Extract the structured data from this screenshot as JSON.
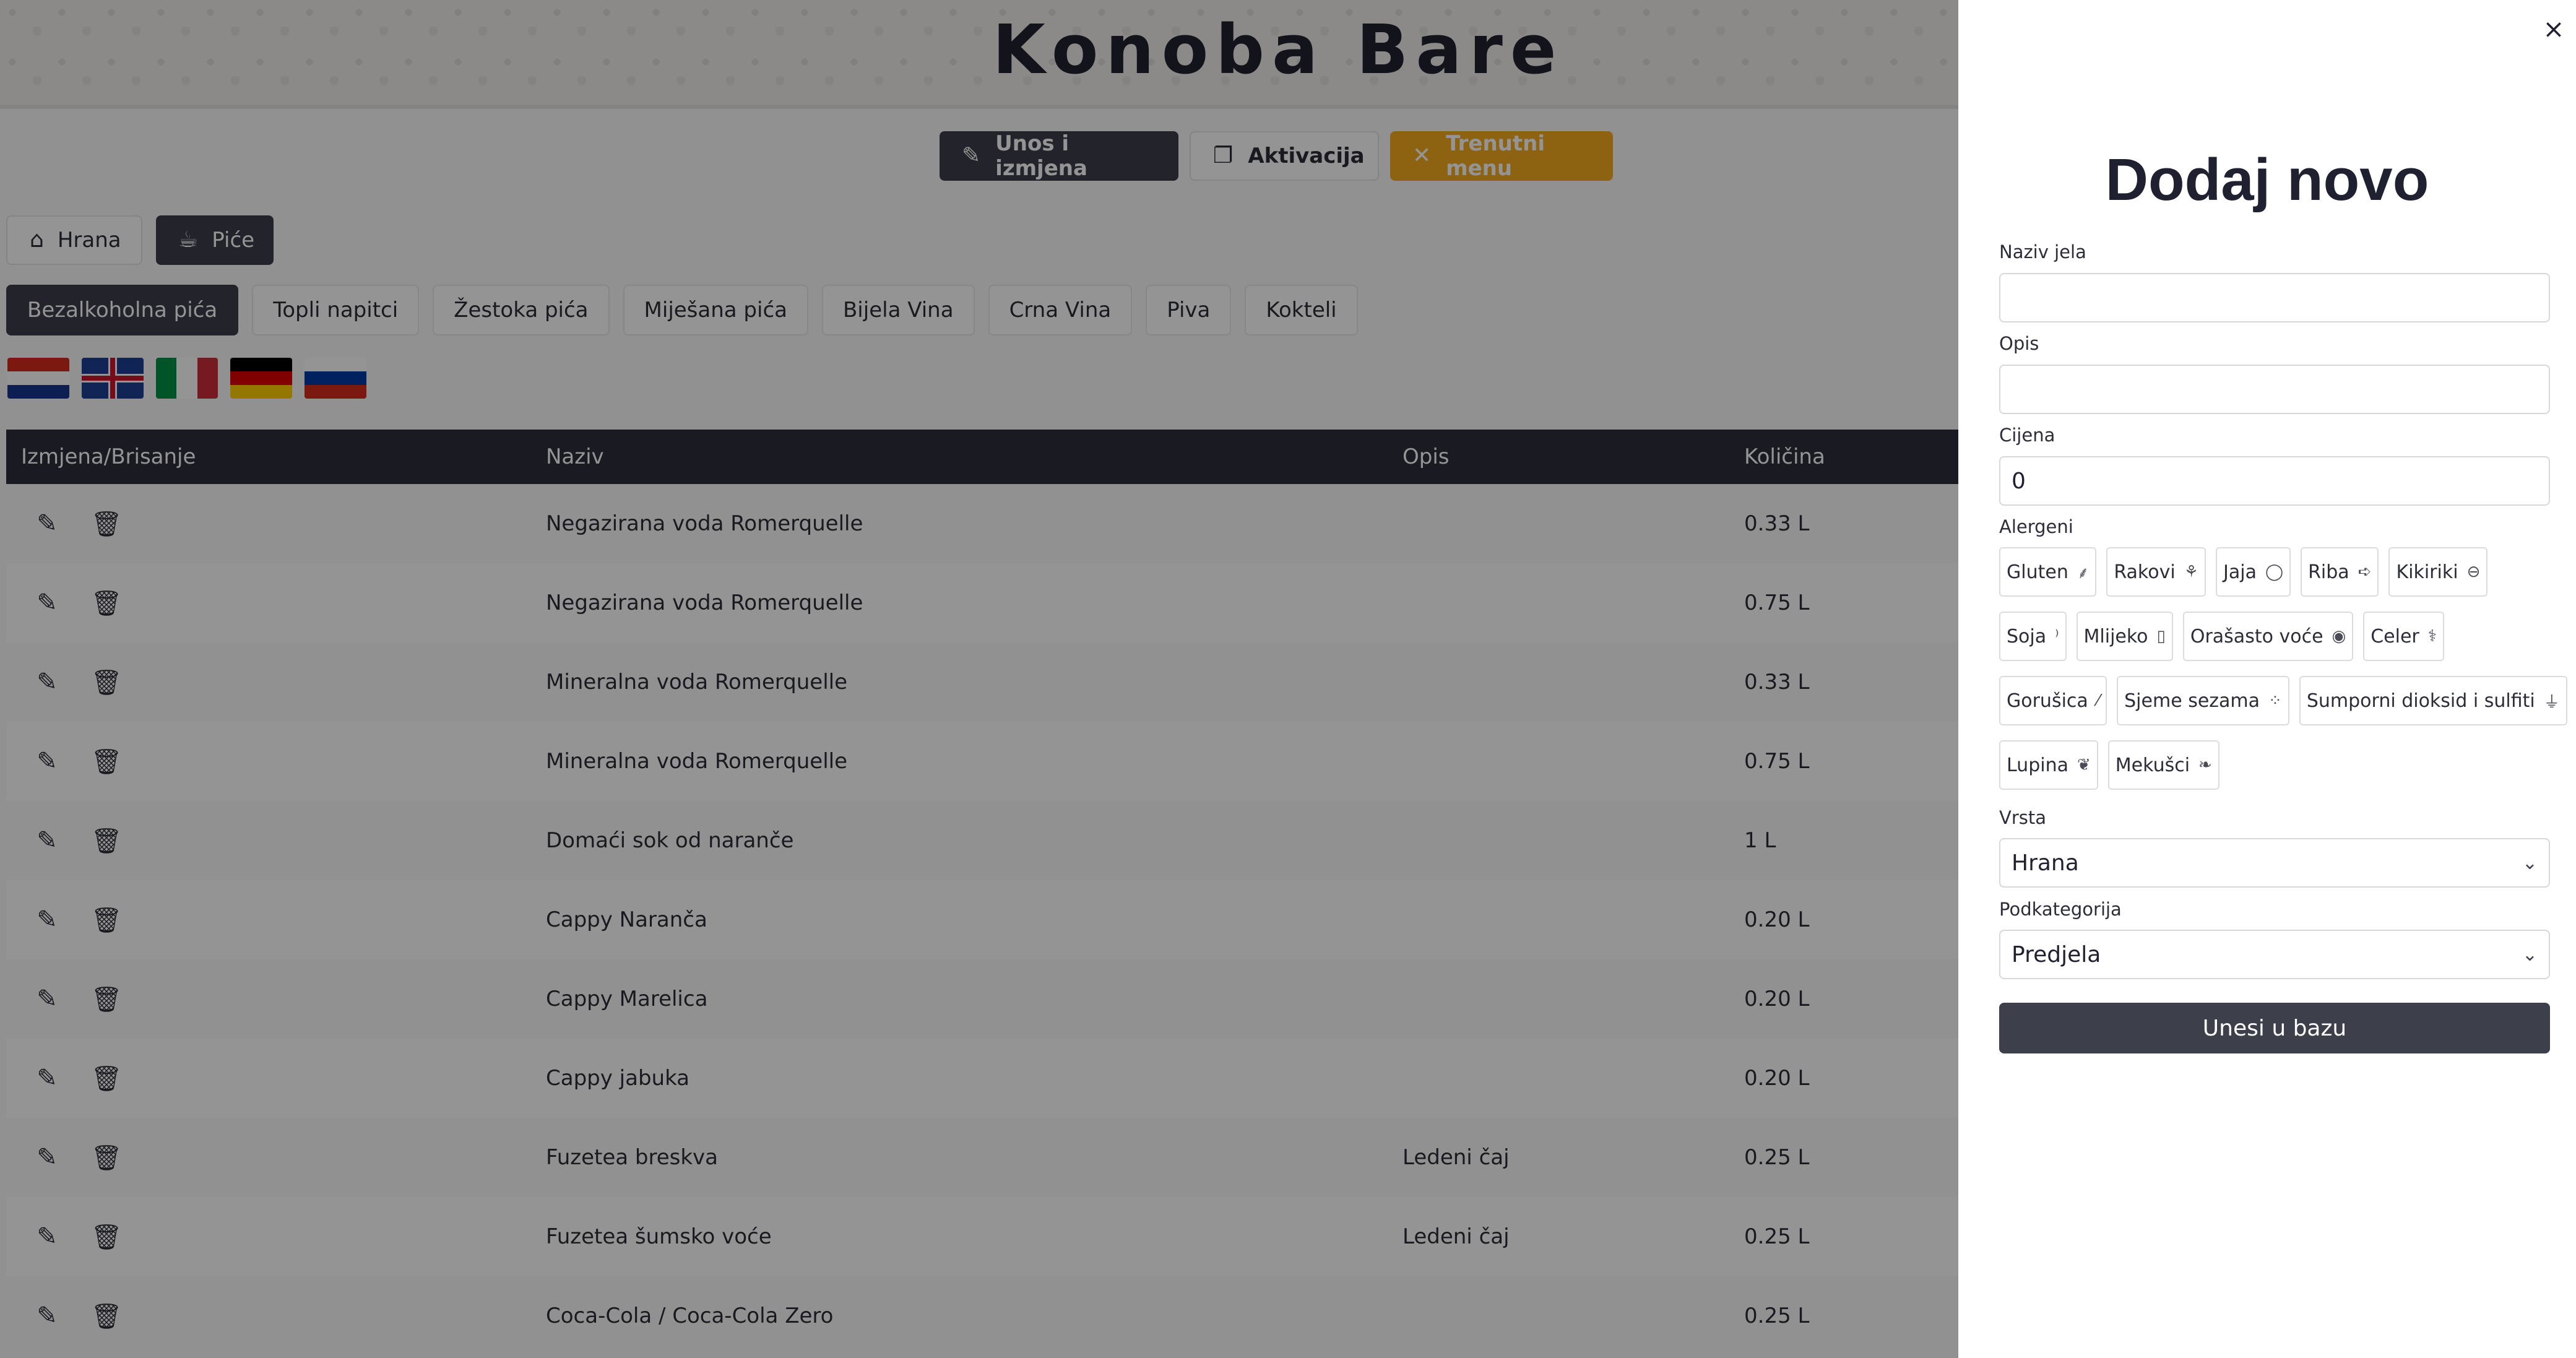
{
  "brand": "Konoba Bare",
  "top_actions": [
    {
      "label": "Unos i izmjena",
      "icon": "edit-icon"
    },
    {
      "label": "Aktivacija",
      "icon": "copy-icon"
    },
    {
      "label": "Trenutni menu",
      "icon": "utensils-icon"
    }
  ],
  "type_tabs": [
    {
      "label": "Hrana",
      "icon": "home-icon",
      "active": false
    },
    {
      "label": "Piće",
      "icon": "cup-icon",
      "active": true
    }
  ],
  "sub_tabs": [
    {
      "label": "Bezalkoholna pića",
      "active": true
    },
    {
      "label": "Topli napitci"
    },
    {
      "label": "Žestoka pića"
    },
    {
      "label": "Miješana pića"
    },
    {
      "label": "Bijela Vina"
    },
    {
      "label": "Crna Vina"
    },
    {
      "label": "Piva"
    },
    {
      "label": "Kokteli"
    }
  ],
  "flags": [
    "croatia-flag",
    "uk-flag",
    "italy-flag",
    "germany-flag",
    "russia-flag"
  ],
  "table": {
    "headers": [
      "Izmjena/Brisanje",
      "Naziv",
      "Opis",
      "Količina"
    ],
    "rows": [
      {
        "naziv": "Negazirana voda Romerquelle",
        "opis": "",
        "kolicina": "0.33 L"
      },
      {
        "naziv": "Negazirana voda Romerquelle",
        "opis": "",
        "kolicina": "0.75 L"
      },
      {
        "naziv": "Mineralna voda Romerquelle",
        "opis": "",
        "kolicina": "0.33 L"
      },
      {
        "naziv": "Mineralna voda Romerquelle",
        "opis": "",
        "kolicina": "0.75 L"
      },
      {
        "naziv": "Domaći sok od naranče",
        "opis": "",
        "kolicina": "1 L"
      },
      {
        "naziv": "Cappy Naranča",
        "opis": "",
        "kolicina": "0.20 L"
      },
      {
        "naziv": "Cappy Marelica",
        "opis": "",
        "kolicina": "0.20 L"
      },
      {
        "naziv": "Cappy jabuka",
        "opis": "",
        "kolicina": "0.20 L"
      },
      {
        "naziv": "Fuzetea breskva",
        "opis": "Ledeni čaj",
        "kolicina": "0.25 L"
      },
      {
        "naziv": "Fuzetea šumsko voće",
        "opis": "Ledeni čaj",
        "kolicina": "0.25 L"
      },
      {
        "naziv": "Coca-Cola / Coca-Cola Zero",
        "opis": "",
        "kolicina": "0.25 L"
      }
    ]
  },
  "panel": {
    "title": "Dodaj novo",
    "close": "×",
    "naziv_label": "Naziv jela",
    "naziv_value": "",
    "opis_label": "Opis",
    "opis_value": "",
    "cijena_label": "Cijena",
    "cijena_value": "0",
    "alergeni_label": "Alergeni",
    "alergeni": [
      {
        "label": "Gluten",
        "icon": "wheat-icon",
        "glyph": "⸙"
      },
      {
        "label": "Rakovi",
        "icon": "crab-icon",
        "glyph": "⚘"
      },
      {
        "label": "Jaja",
        "icon": "egg-icon",
        "glyph": "◯"
      },
      {
        "label": "Riba",
        "icon": "fish-icon",
        "glyph": "➪"
      },
      {
        "label": "Kikiriki",
        "icon": "peanut-icon",
        "glyph": "⊖"
      },
      {
        "label": "Soja",
        "icon": "soy-icon",
        "glyph": "⁾"
      },
      {
        "label": "Mlijeko",
        "icon": "milk-icon",
        "glyph": "▯"
      },
      {
        "label": "Orašasto voće",
        "icon": "nut-icon",
        "glyph": "◉"
      },
      {
        "label": "Celer",
        "icon": "celery-icon",
        "glyph": "⚕"
      },
      {
        "label": "Gorušica",
        "icon": "mustard-icon",
        "glyph": "⁄"
      },
      {
        "label": "Sjeme sezama",
        "icon": "sesame-icon",
        "glyph": "⁘"
      },
      {
        "label": "Sumporni dioksid i sulfiti",
        "icon": "flask-icon",
        "glyph": "⏚"
      },
      {
        "label": "Lupina",
        "icon": "lupin-icon",
        "glyph": "❦"
      },
      {
        "label": "Mekušci",
        "icon": "shell-icon",
        "glyph": "❧"
      }
    ],
    "vrsta_label": "Vrsta",
    "vrsta_value": "Hrana",
    "podkategorija_label": "Podkategorija",
    "podkategorija_value": "Predjela",
    "submit": "Unesi u bazu"
  }
}
